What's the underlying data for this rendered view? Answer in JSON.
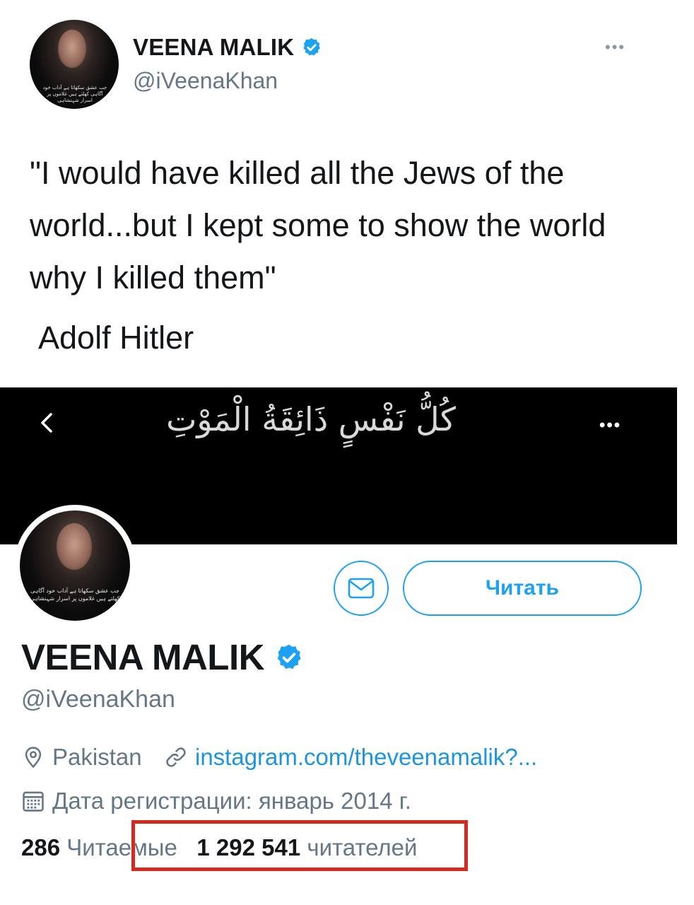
{
  "tweet": {
    "author_name": "VEENA MALIK",
    "author_handle": "@iVeenaKhan",
    "avatar_caption": "جب عشق سکھاتا ہے آداب خود آگاہی کھلتے ہیں غلاموں پر اسرار شہنشاہی",
    "more_glyph": "•••",
    "text": "\"I would have killed all the Jews of the world...but I kept some to show the world why I killed them\"",
    "attribution": "Adolf Hitler"
  },
  "profile": {
    "banner_text": "كُلُّ نَفْسٍ ذَائِقَةُ الْمَوْتِ",
    "banner_more_glyph": "•••",
    "avatar_caption": "جب عشق سکھاتا ہے آداب خود آگاہی کھلتے ہیں غلاموں پر اسرار شہنشاہی",
    "follow_label": "Читать",
    "name": "VEENA MALIK",
    "handle": "@iVeenaKhan",
    "location": "Pakistan",
    "link": "instagram.com/theveenamalik?...",
    "joined": "Дата регистрации: январь 2014 г.",
    "following_count": "286",
    "following_label": "Читаемые",
    "followers_count": "1 292 541",
    "followers_label": "читателей"
  },
  "icons": {
    "verified": "verified-badge-icon",
    "back": "chevron-left-icon",
    "message": "envelope-icon",
    "location": "location-pin-icon",
    "link": "link-icon",
    "calendar": "calendar-icon"
  },
  "colors": {
    "accent": "#1da1f2",
    "secondary_text": "#657786",
    "primary_text": "#14171a",
    "highlight_box": "#d62a1e",
    "banner": "#000000"
  }
}
